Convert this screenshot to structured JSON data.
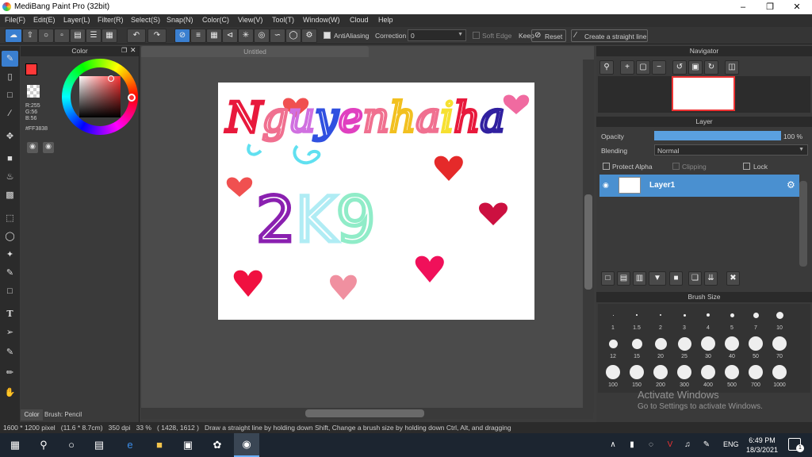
{
  "window": {
    "title": "MediBang Paint Pro (32bit)"
  },
  "menu": [
    "File(F)",
    "Edit(E)",
    "Layer(L)",
    "Filter(R)",
    "Select(S)",
    "Snap(N)",
    "Color(C)",
    "View(V)",
    "Tool(T)",
    "Window(W)",
    "Cloud",
    "Help"
  ],
  "toolbar": {
    "antialiasing": "AntiAliasing",
    "correction_label": "Correction",
    "correction_value": "0",
    "soft_edge": "Soft Edge",
    "keep": "Keep",
    "reset": "Reset",
    "straight_line": "Create a straight line"
  },
  "color_panel": {
    "title": "Color",
    "rgb": [
      "R:255",
      "G:56",
      "B:56"
    ],
    "hex": "#FF3838",
    "tab_color": "Color",
    "tab_brush": "Brush: Pencil",
    "primary_color": "#ff3838"
  },
  "document": {
    "tab": "Untitled",
    "artwork": {
      "line1": "Nguyenhaiha",
      "line2": "2K9"
    }
  },
  "navigator": {
    "title": "Navigator"
  },
  "layer_panel": {
    "title": "Layer",
    "opacity_label": "Opacity",
    "opacity_value": "100 %",
    "opacity": 1.0,
    "blending_label": "Blending",
    "blending_value": "Normal",
    "protect_alpha": "Protect Alpha",
    "clipping": "Clipping",
    "lock": "Lock",
    "layer_name": "Layer1"
  },
  "brush_panel": {
    "title": "Brush Size",
    "sizes": [
      "1",
      "1.5",
      "2",
      "3",
      "4",
      "5",
      "7",
      "10",
      "12",
      "15",
      "20",
      "25",
      "30",
      "40",
      "50",
      "70",
      "100",
      "150",
      "200",
      "300",
      "400",
      "500",
      "700",
      "1000"
    ]
  },
  "status": {
    "text": "1600 * 1200 pixel   (11.6 * 8.7cm)   350 dpi   33 %   ( 1428, 1612 )   Draw a straight line by holding down Shift, Change a brush size by holding down Ctrl, Alt, and dragging"
  },
  "watermark": {
    "line1": "Activate Windows",
    "line2": "Go to Settings to activate Windows."
  },
  "taskbar": {
    "lang": "ENG",
    "time": "6:49 PM",
    "date": "18/3/2021",
    "notif": "1"
  }
}
